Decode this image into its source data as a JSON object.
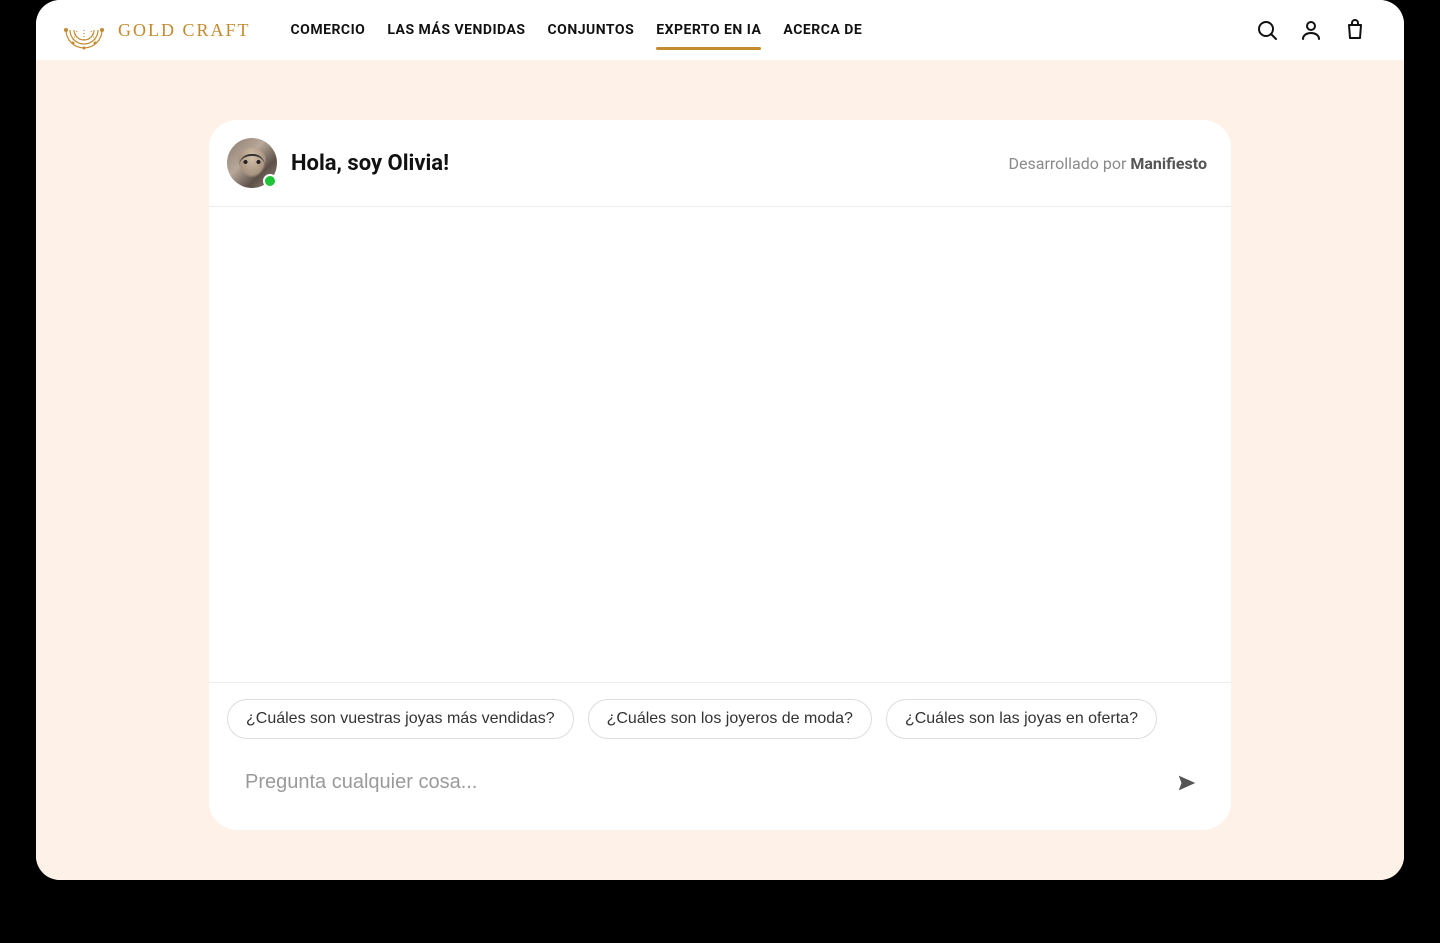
{
  "brand": {
    "name": "GOLD CRAFT"
  },
  "nav": {
    "items": [
      {
        "label": "COMERCIO",
        "active": false
      },
      {
        "label": "LAS MÁS VENDIDAS",
        "active": false
      },
      {
        "label": "CONJUNTOS",
        "active": false
      },
      {
        "label": "EXPERTO EN IA",
        "active": true
      },
      {
        "label": "ACERCA DE",
        "active": false
      }
    ]
  },
  "header_icons": {
    "search": "search-icon",
    "account": "account-icon",
    "bag": "shopping-bag-icon"
  },
  "chat": {
    "title": "Hola, soy Olivia!",
    "presence": "online",
    "powered_by_prefix": "Desarrollado por ",
    "powered_by_brand": "Manifiesto",
    "suggestions": [
      "¿Cuáles son vuestras joyas más vendidas?",
      "¿Cuáles son los joyeros de moda?",
      "¿Cuáles son las joyas en oferta?"
    ],
    "input_placeholder": "Pregunta cualquier cosa...",
    "input_value": ""
  },
  "colors": {
    "accent": "#c48a2e",
    "page_bg": "#fef2e8",
    "presence_online": "#1ec337"
  }
}
